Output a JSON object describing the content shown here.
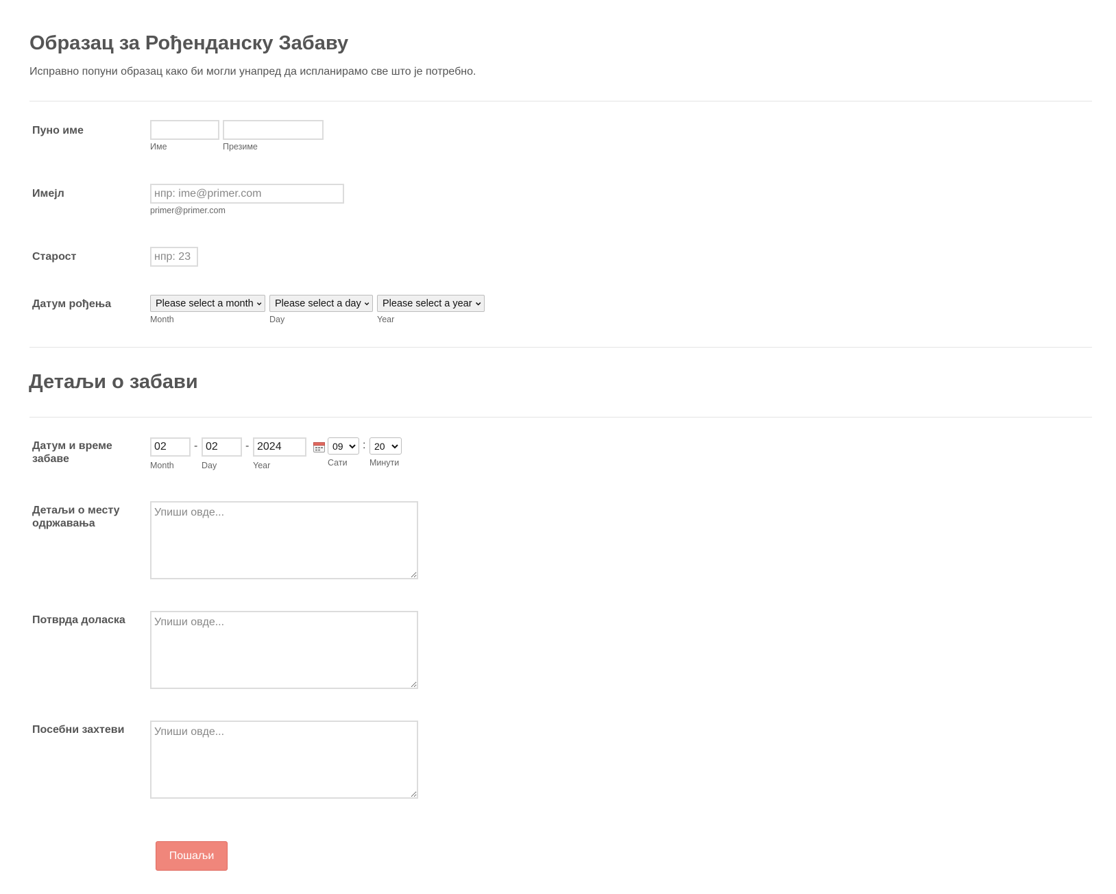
{
  "header": {
    "title": "Образац за Рођенданску Забаву",
    "subtitle": "Исправно попуни образац како би могли унапред да испланирамо све што је потребно."
  },
  "fields": {
    "full_name": {
      "label": "Пуно име",
      "first_sublabel": "Име",
      "last_sublabel": "Презиме",
      "first_value": "",
      "last_value": ""
    },
    "email": {
      "label": "Имејл",
      "placeholder": "нпр: ime@primer.com",
      "value": "",
      "sublabel": "primer@primer.com"
    },
    "age": {
      "label": "Старост",
      "placeholder": "нпр: 23",
      "value": ""
    },
    "birth_date": {
      "label": "Датум рођења",
      "month_select": "Please select a month",
      "day_select": "Please select a day",
      "year_select": "Please select a year",
      "month_sublabel": "Month",
      "day_sublabel": "Day",
      "year_sublabel": "Year"
    }
  },
  "section2": {
    "title": "Детаљи о забави"
  },
  "party_datetime": {
    "label": "Датум и време забаве",
    "month_value": "02",
    "day_value": "02",
    "year_value": "2024",
    "separator_date": "-",
    "separator_time": ":",
    "hour_value": "09",
    "minute_value": "20",
    "month_sublabel": "Month",
    "day_sublabel": "Day",
    "year_sublabel": "Year",
    "hour_sublabel": "Сати",
    "minute_sublabel": "Минути",
    "calendar_icon": "calendar-icon"
  },
  "venue": {
    "label": "Детаљи о месту одржавања",
    "placeholder": "Упиши овде..."
  },
  "rsvp": {
    "label": "Потврда доласка",
    "placeholder": "Упиши овде..."
  },
  "requests": {
    "label": "Посебни захтеви",
    "placeholder": "Упиши овде..."
  },
  "submit": {
    "label": "Пошаљи",
    "color": "#f0867b"
  }
}
